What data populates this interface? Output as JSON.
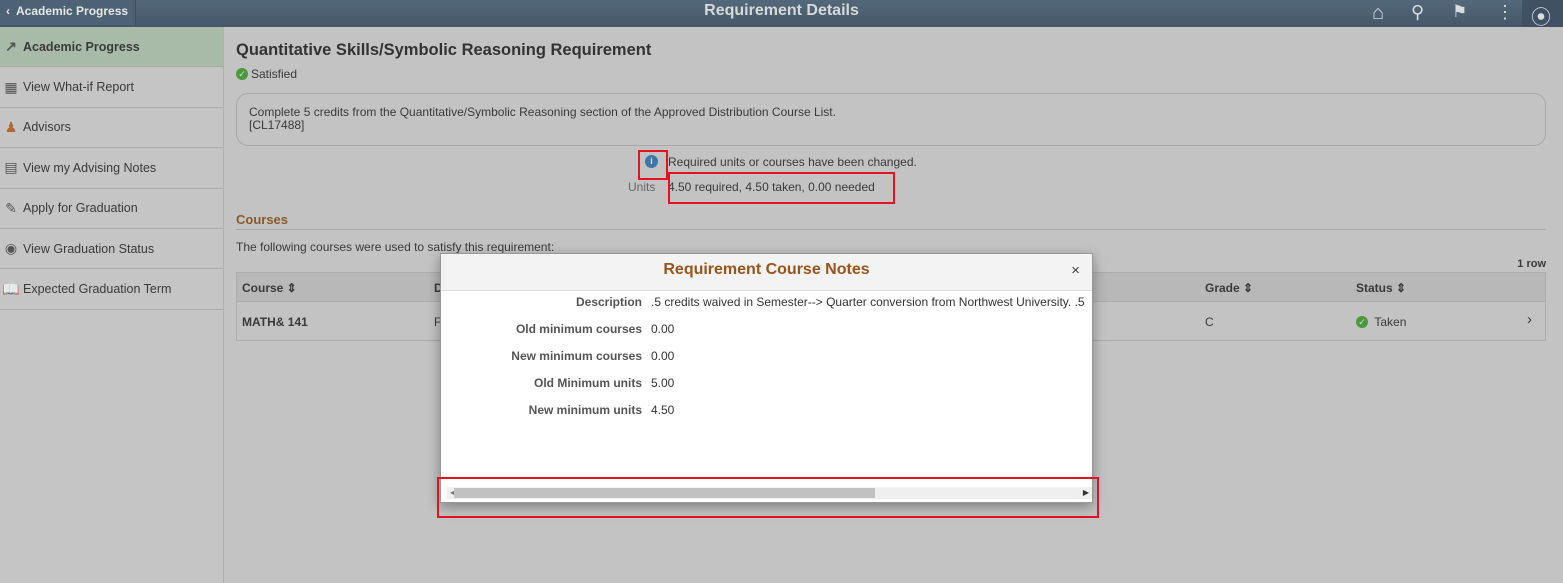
{
  "topbar": {
    "back_label": "Academic Progress",
    "title": "Requirement Details",
    "icons": [
      "home-icon",
      "search-icon",
      "flag-icon",
      "more-vertical-icon",
      "navbar-compass-icon"
    ],
    "color": "#4a5f71"
  },
  "sidebar": {
    "items": [
      {
        "label": "Academic Progress",
        "icon": "chart-line-icon",
        "active": true
      },
      {
        "label": "View What-if Report",
        "icon": "report-icon"
      },
      {
        "label": "Advisors",
        "icon": "people-icon"
      },
      {
        "label": "View my Advising Notes",
        "icon": "clipboard-icon"
      },
      {
        "label": "Apply for Graduation",
        "icon": "application-icon"
      },
      {
        "label": "View Graduation Status",
        "icon": "graduation-cap-icon"
      },
      {
        "label": "Expected Graduation Term",
        "icon": "book-icon"
      }
    ]
  },
  "main": {
    "title": "Quantitative Skills/Symbolic Reasoning Requirement",
    "status": "Satisfied",
    "description": "Complete 5 credits from the Quantitative/Symbolic Reasoning section of the Approved Distribution Course List.",
    "code": "[CL17488]",
    "info_text": "Required units or courses have been changed.",
    "units_label": "Units",
    "units_value": "4.50 required, 4.50 taken, 0.00 needed",
    "courses_heading": "Courses",
    "courses_intro": "The following courses were used to satisfy this requirement:",
    "row_count": "1 row",
    "table": {
      "headers": [
        "Course",
        "D",
        "Grade",
        "Status"
      ],
      "rows": [
        {
          "course": "MATH& 141",
          "description": "F",
          "grade": "C",
          "status": "Taken"
        }
      ]
    }
  },
  "modal": {
    "title": "Requirement Course Notes",
    "close": "×",
    "fields": [
      {
        "label": "Description",
        "value": ".5 credits waived in Semester--> Quarter conversion from Northwest University. .5"
      },
      {
        "label": "Old minimum courses",
        "value": "0.00"
      },
      {
        "label": "New minimum courses",
        "value": "0.00"
      },
      {
        "label": "Old Minimum units",
        "value": "5.00"
      },
      {
        "label": "New minimum units",
        "value": "4.50"
      }
    ],
    "scroll_position": 0
  },
  "colors": {
    "accent": "#9a5419",
    "highlight_box": "#e0141e",
    "success": "#4b9a3a",
    "info": "#3b78a8"
  }
}
